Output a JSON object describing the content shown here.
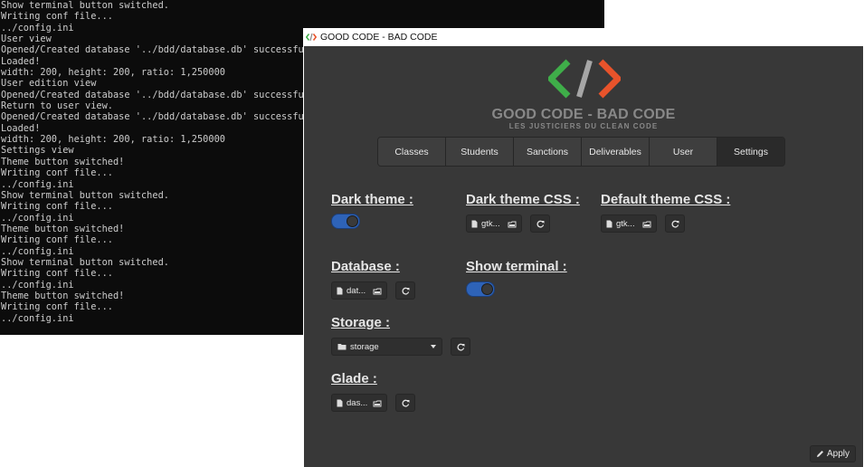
{
  "terminal": {
    "lines": [
      "Show terminal button switched.",
      "Writing conf file...",
      "../config.ini",
      "User view",
      "Opened/Created database '../bdd/database.db' successfully",
      "Loaded!",
      "width: 200, height: 200, ratio: 1,250000",
      "User edition view",
      "Opened/Created database '../bdd/database.db' successfully",
      "Return to user view.",
      "Opened/Created database '../bdd/database.db' successfully",
      "Loaded!",
      "width: 200, height: 200, ratio: 1,250000",
      "Settings view",
      "Theme button switched!",
      "Writing conf file...",
      "../config.ini",
      "Show terminal button switched.",
      "Writing conf file...",
      "../config.ini",
      "Theme button switched!",
      "Writing conf file...",
      "../config.ini",
      "Show terminal button switched.",
      "Writing conf file...",
      "../config.ini",
      "Theme button switched!",
      "Writing conf file...",
      "../config.ini"
    ]
  },
  "window": {
    "icon_name": "code-icon",
    "title": "GOOD CODE - BAD CODE"
  },
  "logo": {
    "title": "GOOD CODE - BAD CODE",
    "subtitle": "LES JUSTICIERS DU CLEAN CODE",
    "colors": {
      "left": "#3fae49",
      "slash": "#a6a6a6",
      "right": "#e8532b"
    }
  },
  "tabs": [
    {
      "label": "Classes",
      "active": false
    },
    {
      "label": "Students",
      "active": false
    },
    {
      "label": "Sanctions",
      "active": false
    },
    {
      "label": "Deliverables",
      "active": false
    },
    {
      "label": "User",
      "active": false
    },
    {
      "label": "Settings",
      "active": true
    }
  ],
  "settings": {
    "dark_theme": {
      "label": "Dark theme :",
      "enabled": true
    },
    "dark_theme_css": {
      "label": "Dark theme CSS :",
      "file": "gtk..."
    },
    "default_theme_css": {
      "label": "Default theme CSS :",
      "file": "gtk..."
    },
    "database": {
      "label": "Database :",
      "file": "dat..."
    },
    "show_terminal": {
      "label": "Show terminal :",
      "enabled": true
    },
    "storage": {
      "label": "Storage :",
      "value": "storage"
    },
    "glade": {
      "label": "Glade :",
      "file": "das..."
    }
  },
  "apply_label": "Apply",
  "colors": {
    "accent": "#2e63b8",
    "background": "#383838",
    "terminal_bg": "#0c0c0c"
  }
}
